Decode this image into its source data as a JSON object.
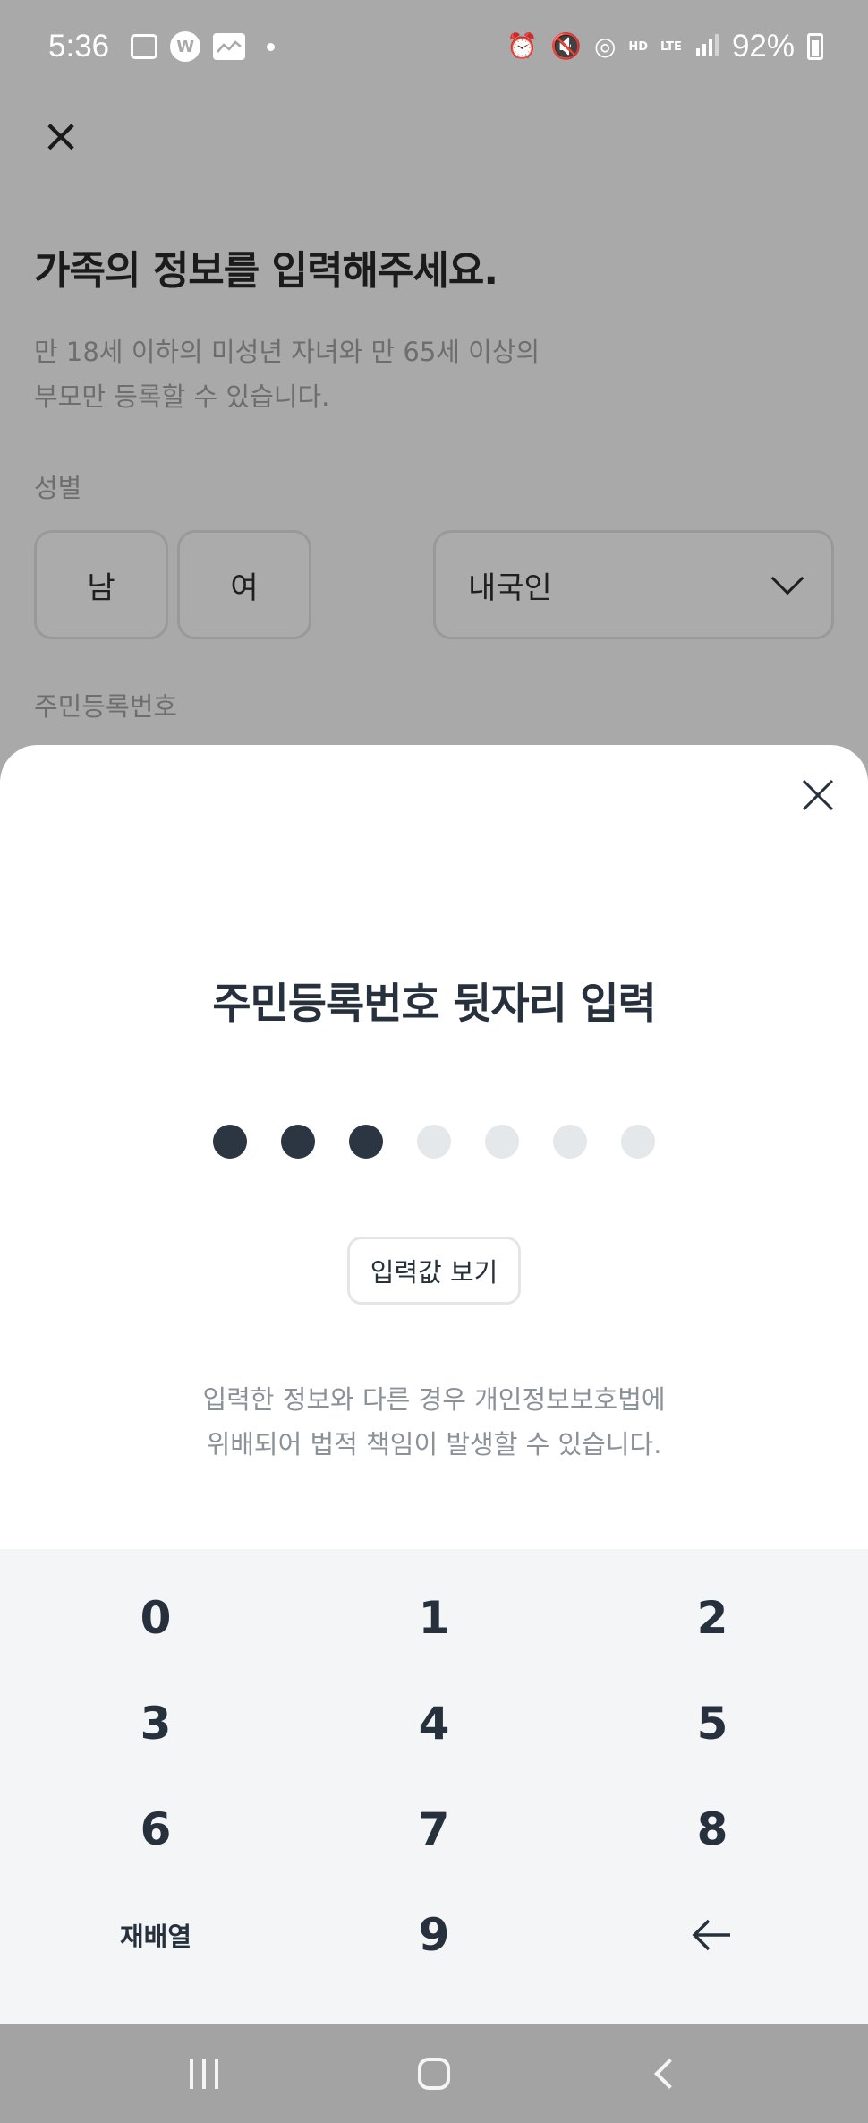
{
  "status_bar": {
    "time": "5:36",
    "battery": "92%",
    "icons": [
      "gallery-icon",
      "w-app-icon",
      "stock-chart-icon",
      "alarm-icon",
      "mute-icon",
      "hotspot-icon",
      "hd-voice-icon",
      "lte-icon",
      "signal-icon",
      "battery-icon"
    ],
    "hd_label": "HD",
    "lte_label": "LTE"
  },
  "background_page": {
    "title": "가족의 정보를 입력해주세요.",
    "description_line1": "만 18세 이하의 미성년 자녀와 만 65세 이상의",
    "description_line2": "부모만 등록할 수 있습니다.",
    "gender_label": "성별",
    "gender_male": "남",
    "gender_female": "여",
    "nationality_value": "내국인",
    "rrn_label": "주민등록번호"
  },
  "sheet": {
    "title": "주민등록번호 뒷자리 입력",
    "pin_length": 7,
    "pin_filled": 3,
    "show_input_label": "입력값 보기",
    "warning_line1": "입력한 정보와 다른 경우 개인정보보호법에",
    "warning_line2": "위배되어 법적 책임이 발생할 수 있습니다."
  },
  "keypad": {
    "keys": [
      "0",
      "1",
      "2",
      "3",
      "4",
      "5",
      "6",
      "7",
      "8",
      "재배열",
      "9",
      "←"
    ]
  },
  "colors": {
    "pin_filled": "#2b3642",
    "pin_empty": "#e5e8eb",
    "keypad_bg": "#f3f5f7",
    "overlay_bg": "#a9a9a9"
  }
}
